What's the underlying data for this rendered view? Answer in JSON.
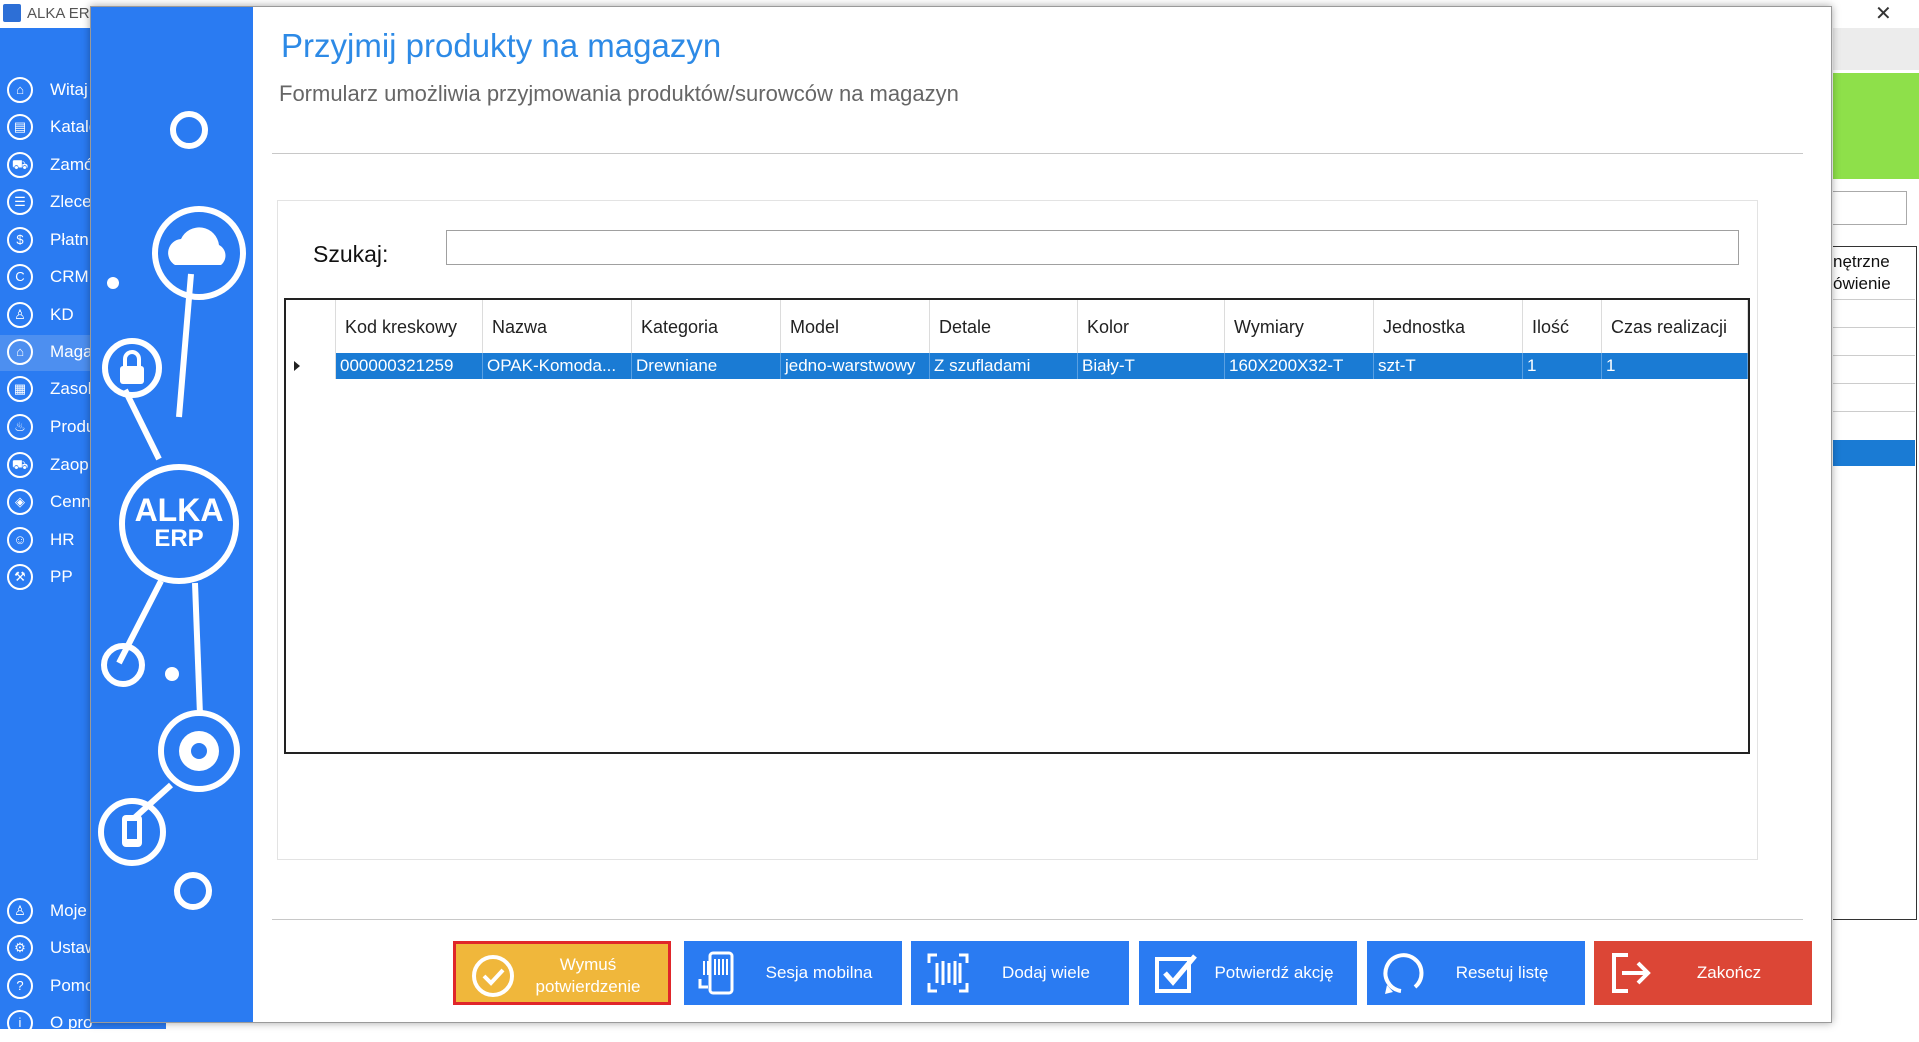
{
  "window": {
    "title": "ALKA ERP"
  },
  "nav": {
    "items": [
      {
        "label": "Witaj",
        "icon": "home-icon",
        "glyph": "⌂"
      },
      {
        "label": "Katalo",
        "icon": "catalog-icon",
        "glyph": "▤"
      },
      {
        "label": "Zamó",
        "icon": "cart-icon",
        "glyph": "⛟"
      },
      {
        "label": "Zlece",
        "icon": "list-icon",
        "glyph": "☰"
      },
      {
        "label": "Płatn",
        "icon": "dollar-icon",
        "glyph": "$"
      },
      {
        "label": "CRM",
        "icon": "crm-icon",
        "glyph": "C"
      },
      {
        "label": "KD",
        "icon": "person-icon",
        "glyph": "♙"
      },
      {
        "label": "Maga",
        "icon": "warehouse-icon",
        "glyph": "⌂"
      },
      {
        "label": "Zasob",
        "icon": "resources-icon",
        "glyph": "▦"
      },
      {
        "label": "Produ",
        "icon": "production-icon",
        "glyph": "♨"
      },
      {
        "label": "Zaop",
        "icon": "truck-icon",
        "glyph": "⛟"
      },
      {
        "label": "Cenn",
        "icon": "tag-icon",
        "glyph": "◈"
      },
      {
        "label": "HR",
        "icon": "hr-icon",
        "glyph": "☺"
      },
      {
        "label": "PP",
        "icon": "pp-icon",
        "glyph": "⚒"
      }
    ],
    "bottom_items": [
      {
        "label": "Moje",
        "icon": "user-icon",
        "glyph": "♙"
      },
      {
        "label": "Ustaw",
        "icon": "settings-icon",
        "glyph": "⚙"
      },
      {
        "label": "Pomo",
        "icon": "help-icon",
        "glyph": "?"
      },
      {
        "label": "O pro",
        "icon": "info-icon",
        "glyph": "i"
      }
    ]
  },
  "background": {
    "grid_header_line1": "nętrzne",
    "grid_header_line2": "ówienie"
  },
  "dialog": {
    "title": "Przyjmij produkty na magazyn",
    "subtitle": "Formularz umożliwia przyjmowania produktów/surowców na magazyn",
    "logo_line1": "ALKA",
    "logo_line2": "ERP",
    "search": {
      "label": "Szukaj:",
      "value": "",
      "placeholder": ""
    },
    "columns": [
      {
        "label": "Kod kreskowy"
      },
      {
        "label": "Nazwa"
      },
      {
        "label": "Kategoria"
      },
      {
        "label": "Model"
      },
      {
        "label": "Detale"
      },
      {
        "label": "Kolor"
      },
      {
        "label": "Wymiary"
      },
      {
        "label": "Jednostka"
      },
      {
        "label": "Ilość"
      },
      {
        "label": "Czas realizacji"
      }
    ],
    "rows": [
      {
        "cells": [
          "000000321259",
          "OPAK-Komoda...",
          "Drewniane",
          "jedno-warstwowy",
          "Z szufladami",
          "Biały-T",
          "160X200X32-T",
          "szt-T",
          "1",
          "1"
        ]
      }
    ],
    "buttons": {
      "force": "Wymuś potwierdzenie",
      "mobile": "Sesja mobilna",
      "add_many": "Dodaj wiele",
      "confirm": "Potwierdź akcję",
      "reset": "Resetuj listę",
      "exit": "Zakończ"
    }
  },
  "colors": {
    "sidebar": "#2a7bf2",
    "title": "#2d8ae6",
    "selection": "#1a7bd4",
    "force_button": "#f0b73b",
    "exit_button": "#dc4636",
    "highlight_border": "#e0262a"
  }
}
